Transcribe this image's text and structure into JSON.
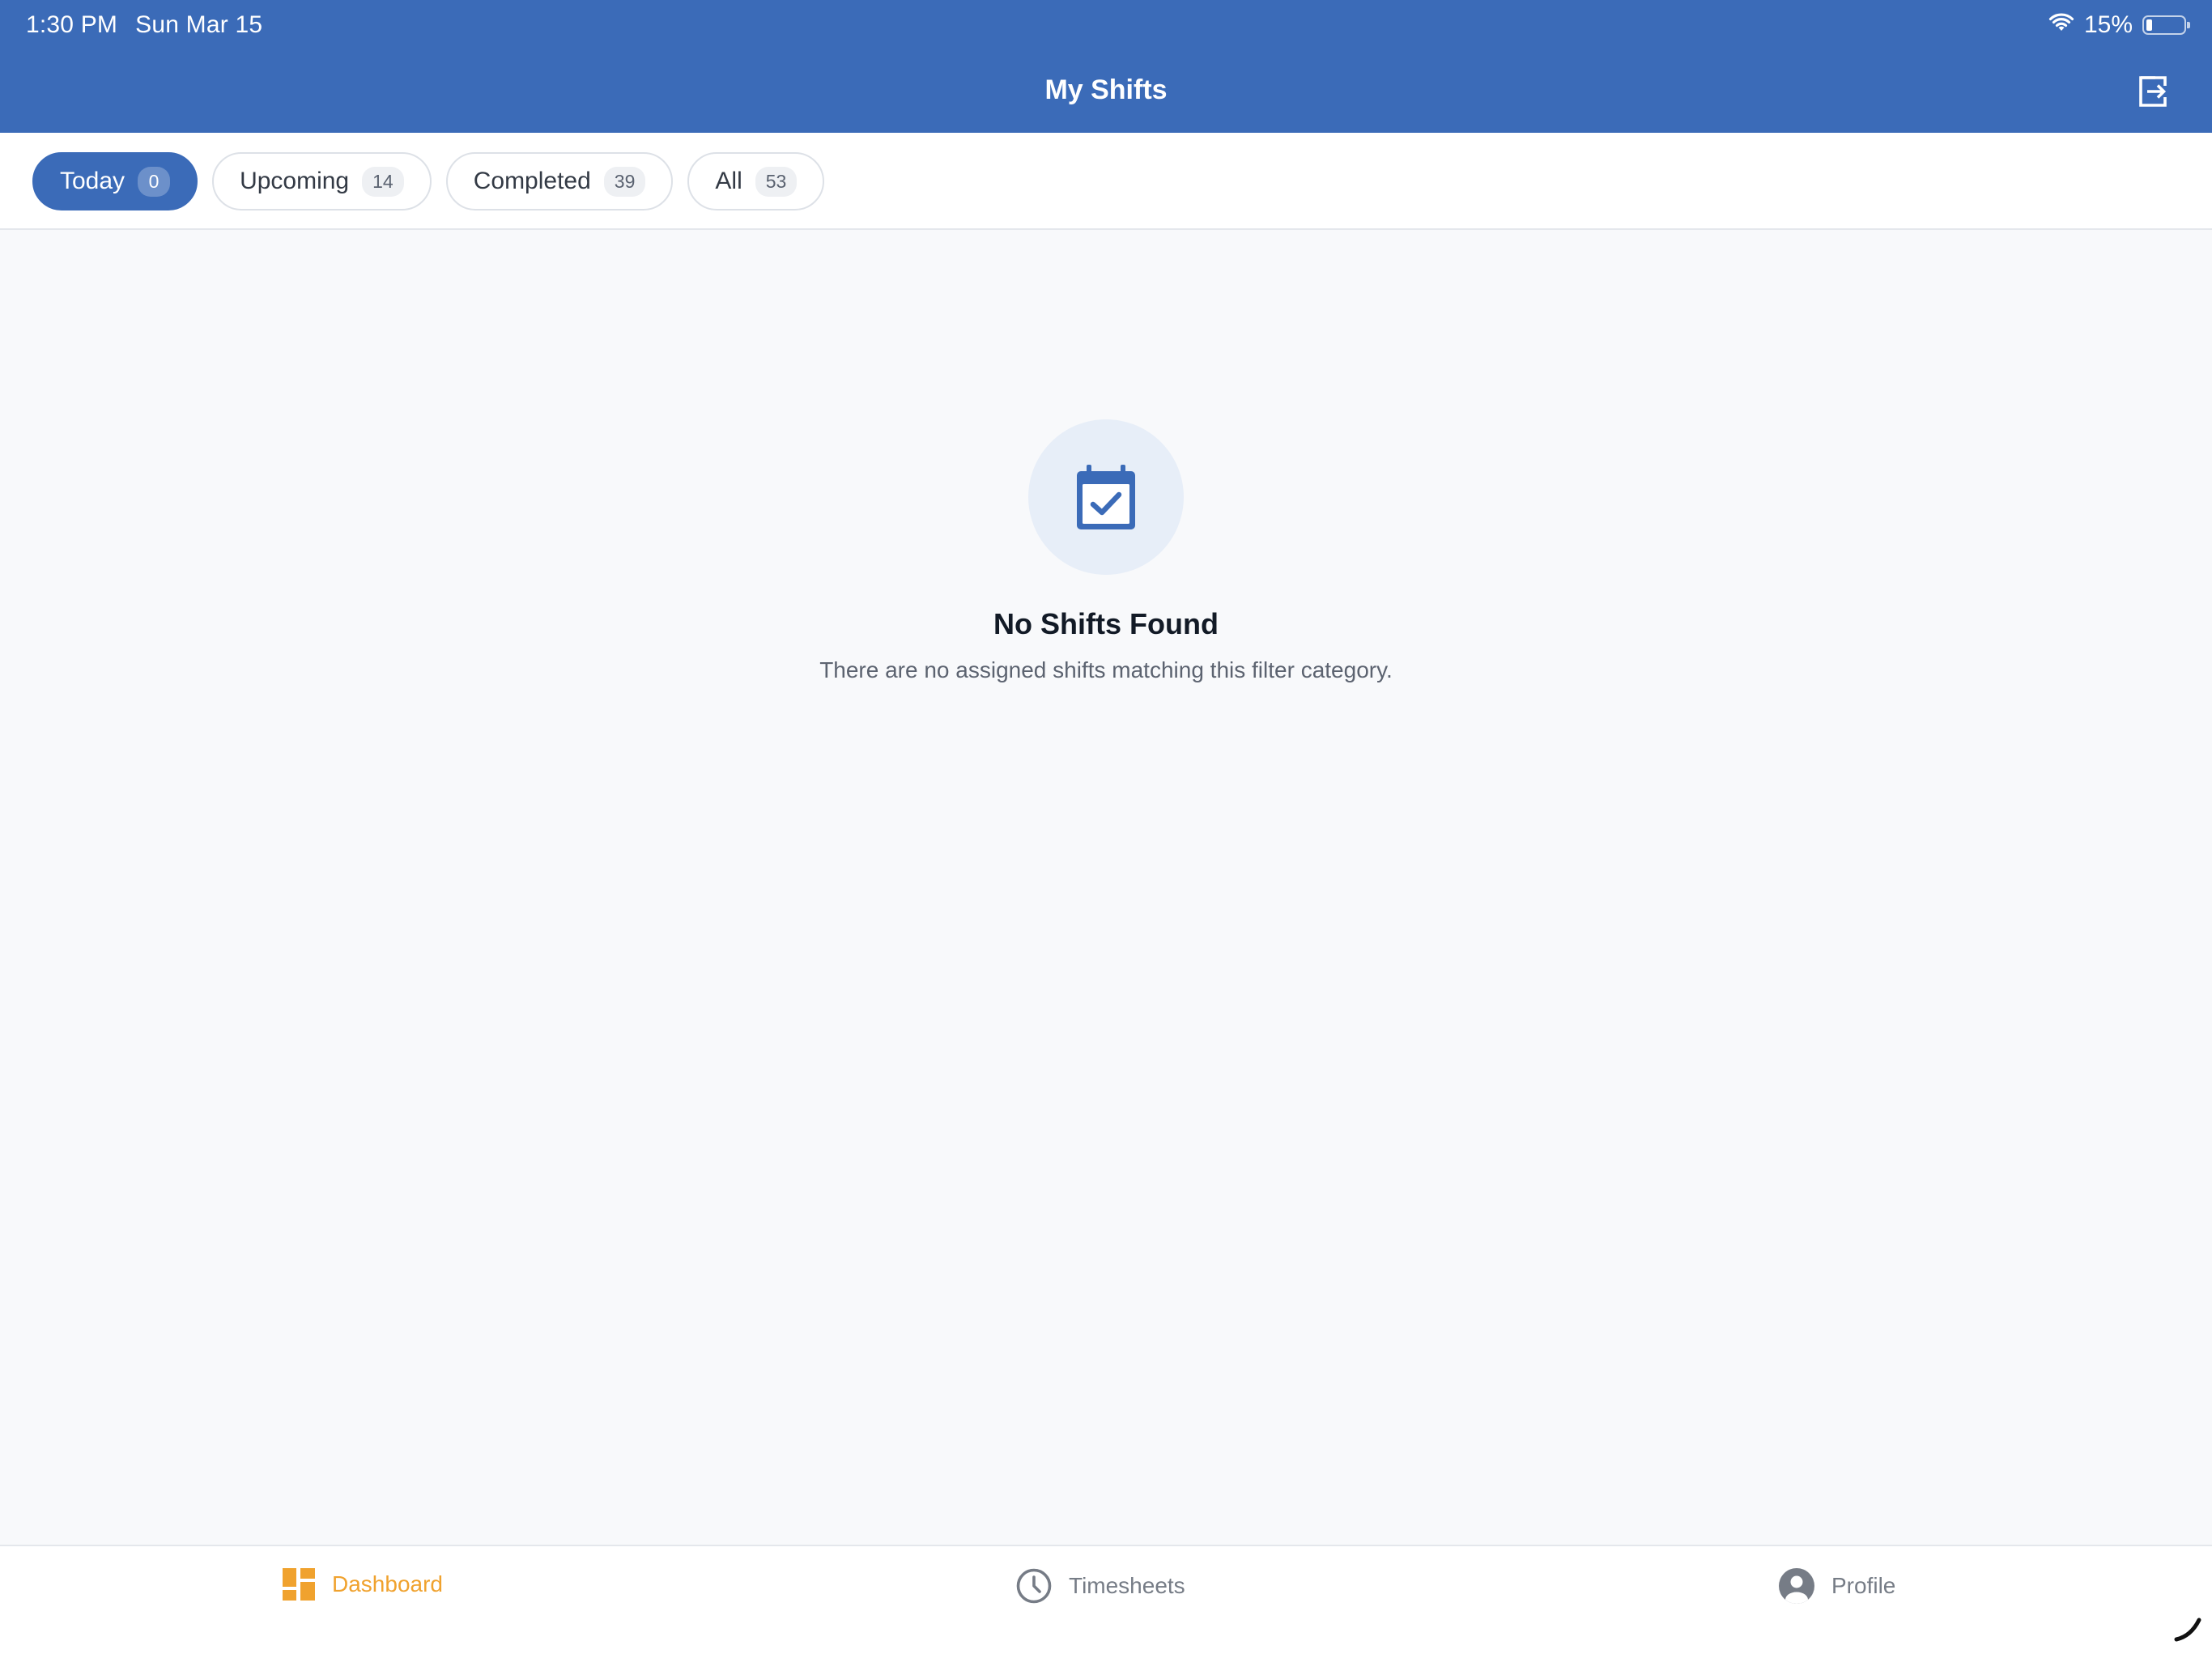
{
  "status_bar": {
    "time": "1:30 PM",
    "date": "Sun Mar 15",
    "battery_percent": "15%",
    "battery_level": 0.15
  },
  "header": {
    "title": "My Shifts",
    "logout_icon": "logout-icon"
  },
  "tabs": [
    {
      "label": "Today",
      "count": "0",
      "active": true
    },
    {
      "label": "Upcoming",
      "count": "14",
      "active": false
    },
    {
      "label": "Completed",
      "count": "39",
      "active": false
    },
    {
      "label": "All",
      "count": "53",
      "active": false
    }
  ],
  "empty_state": {
    "icon": "calendar-check-icon",
    "title": "No Shifts Found",
    "message": "There are no assigned shifts matching this filter category."
  },
  "bottom_nav": {
    "items": [
      {
        "label": "Dashboard",
        "icon": "dashboard-icon",
        "active": true
      },
      {
        "label": "Timesheets",
        "icon": "clock-icon",
        "active": false
      },
      {
        "label": "Profile",
        "icon": "user-icon",
        "active": false
      }
    ]
  },
  "colors": {
    "primary": "#3b6bb8",
    "accent": "#f0a22e",
    "background": "#f8f9fb"
  }
}
